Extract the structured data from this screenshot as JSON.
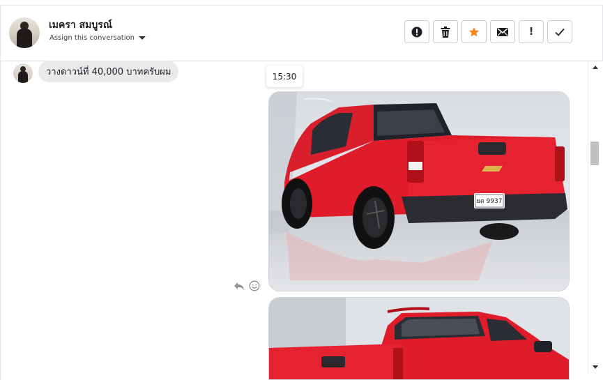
{
  "header": {
    "contact_name": "เมครา สมบูรณ์",
    "assign_label": "Assign this conversation",
    "actions": [
      {
        "name": "spam",
        "icon": "alert-circle-icon"
      },
      {
        "name": "delete",
        "icon": "trash-icon"
      },
      {
        "name": "star",
        "icon": "star-icon",
        "color": "#f28b1f"
      },
      {
        "name": "mail",
        "icon": "mail-icon"
      },
      {
        "name": "important",
        "icon": "exclamation-icon",
        "glyph": "!"
      },
      {
        "name": "done",
        "icon": "check-icon"
      }
    ]
  },
  "messages": [
    {
      "direction": "incoming",
      "text": "วางดาวน์ที่ 40,000 บาทครับผม"
    },
    {
      "direction": "outgoing",
      "time": "15:30",
      "type": "image"
    }
  ],
  "colors": {
    "bubble_incoming": "#e9eaec",
    "accent_star": "#f28b1f",
    "truck_red": "#e01c2a"
  }
}
